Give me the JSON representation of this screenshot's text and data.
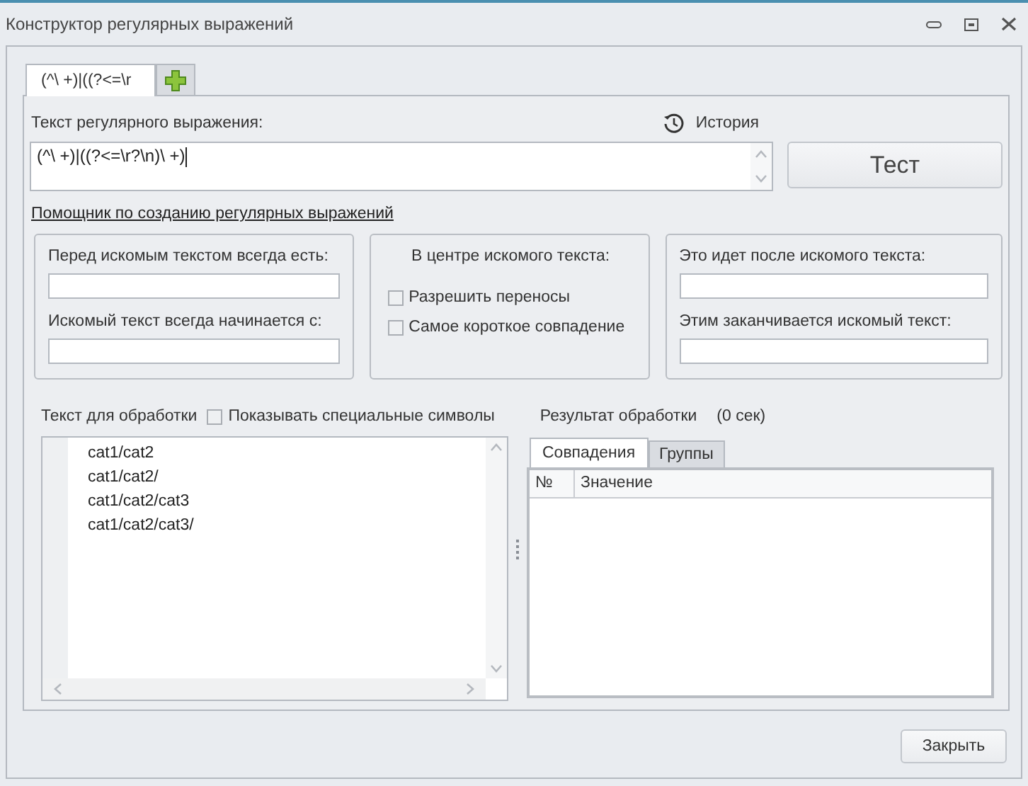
{
  "window": {
    "title": "Конструктор регулярных выражений"
  },
  "tabs": [
    {
      "kind": "text",
      "label": "(^\\ +)|((?<=\\r",
      "selected": true
    },
    {
      "kind": "add",
      "selected": false
    }
  ],
  "regex": {
    "label": "Текст регулярного выражения:",
    "history": "История",
    "value": "(^\\ +)|((?<=\\r?\\n)\\ +)",
    "test_button": "Тест"
  },
  "helper": {
    "link": "Помощник по созданию регулярных выражений",
    "panels": [
      {
        "kind": "fields",
        "fields": [
          {
            "label": "Перед искомым текстом всегда есть:"
          },
          {
            "label": "Искомый текст всегда начинается с:"
          }
        ]
      },
      {
        "kind": "options",
        "title": "В центре искомого текста:",
        "options": [
          {
            "label": "Разрешить переносы",
            "checked": false
          },
          {
            "label": "Самое короткое совпадение",
            "checked": false
          }
        ]
      },
      {
        "kind": "fields",
        "fields": [
          {
            "label": "Это идет после искомого текста:"
          },
          {
            "label": "Этим заканчивается искомый текст:"
          }
        ]
      }
    ]
  },
  "input": {
    "label": "Текст для обработки",
    "show_special": {
      "label": "Показывать специальные символы",
      "checked": false
    },
    "lines": [
      "cat1/cat2",
      "cat1/cat2/",
      "cat1/cat2/cat3",
      "cat1/cat2/cat3/"
    ]
  },
  "result": {
    "label": "Результат обработки",
    "time": "(0 сек)",
    "tabs": [
      {
        "label": "Совпадения",
        "selected": true
      },
      {
        "label": "Группы",
        "selected": false
      }
    ],
    "columns": [
      "№",
      "Значение"
    ]
  },
  "close_button": "Закрыть"
}
